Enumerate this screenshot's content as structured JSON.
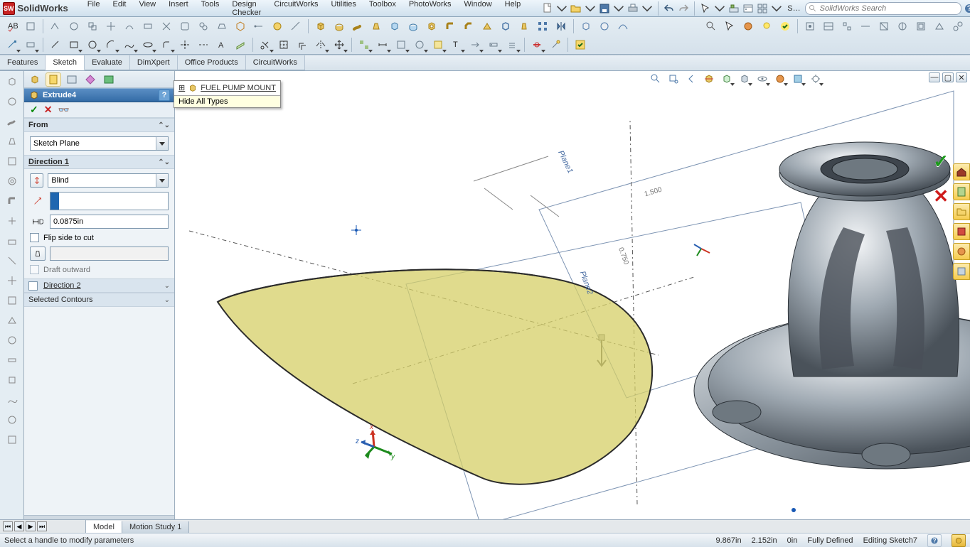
{
  "app": {
    "logo": "SW",
    "title": "SolidWorks"
  },
  "menu": [
    "File",
    "Edit",
    "View",
    "Insert",
    "Tools",
    "Design Checker",
    "CircuitWorks",
    "Utilities",
    "Toolbox",
    "PhotoWorks",
    "Window",
    "Help"
  ],
  "search": {
    "placeholder": "SolidWorks Search"
  },
  "quickbar_right": {
    "label": "S…"
  },
  "cm_tabs": [
    "Features",
    "Sketch",
    "Evaluate",
    "DimXpert",
    "Office Products",
    "CircuitWorks"
  ],
  "cm_active": 1,
  "treefly": {
    "node": "FUEL PUMP MOUNT",
    "tooltip": "Hide All Types"
  },
  "prop": {
    "title": "Extrude4",
    "from": {
      "label": "From",
      "value": "Sketch Plane"
    },
    "dir1": {
      "label": "Direction 1",
      "end": "Blind",
      "dist": "0.0875in",
      "flip": "Flip side to cut",
      "draft_field": "",
      "draft_outward": "Draft outward"
    },
    "dir2": {
      "label": "Direction 2"
    },
    "sel": {
      "label": "Selected Contours"
    }
  },
  "viewport": {
    "planes": {
      "p1": "Plane1",
      "p2": "Plane2"
    },
    "dims": {
      "d1": "1.500",
      "d2": "0.750"
    }
  },
  "bottom_tabs": [
    "Model",
    "Motion Study 1"
  ],
  "bottom_active": 0,
  "status": {
    "msg": "Select a handle to modify parameters",
    "x": "9.867in",
    "y": "2.152in",
    "z": "0in",
    "state": "Fully Defined",
    "ctx": "Editing Sketch7"
  }
}
